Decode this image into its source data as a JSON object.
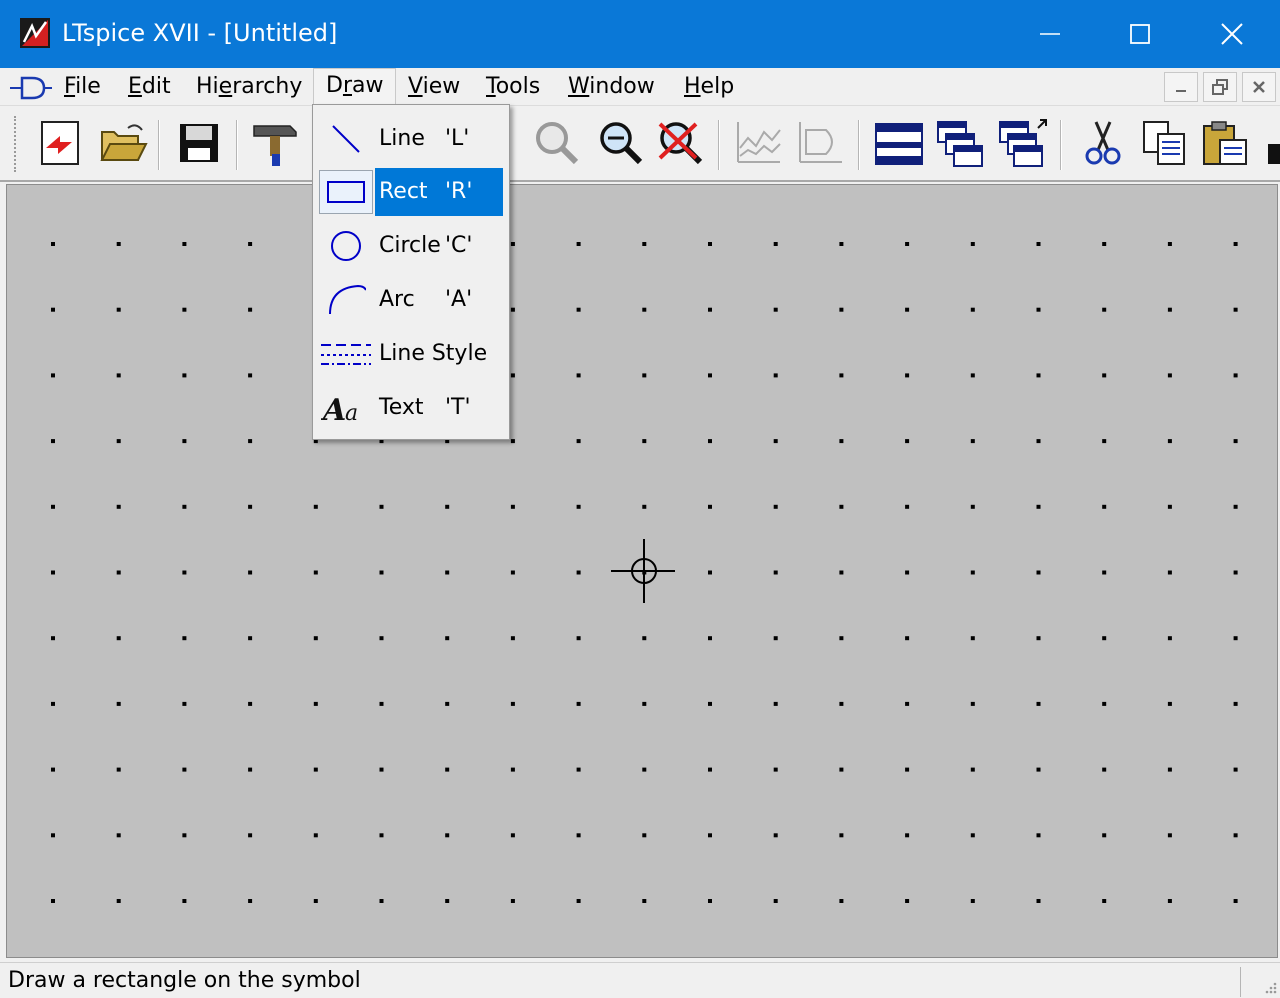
{
  "window": {
    "title": "LTspice XVII - [Untitled]"
  },
  "menubar": {
    "items": [
      {
        "label": "File"
      },
      {
        "label": "Edit"
      },
      {
        "label": "Hierarchy"
      },
      {
        "label": "Draw"
      },
      {
        "label": "View"
      },
      {
        "label": "Tools"
      },
      {
        "label": "Window"
      },
      {
        "label": "Help"
      }
    ]
  },
  "draw_menu": {
    "items": [
      {
        "label": "Line",
        "accel": "'L'",
        "icon": "line-icon"
      },
      {
        "label": "Rect",
        "accel": "'R'",
        "icon": "rect-icon",
        "selected": true
      },
      {
        "label": "Circle",
        "accel": "'C'",
        "icon": "circle-icon"
      },
      {
        "label": "Arc",
        "accel": "'A'",
        "icon": "arc-icon"
      },
      {
        "label": "Line Style",
        "accel": "",
        "icon": "line-style-icon"
      },
      {
        "label": "Text",
        "accel": "'T'",
        "icon": "text-icon"
      }
    ]
  },
  "toolbar": {
    "icons": [
      "new-schematic-icon",
      "open-folder-icon",
      "save-icon",
      "run-hammer-icon",
      "zoom-in-icon",
      "zoom-out-icon",
      "zoom-cancel-icon",
      "autoscale-icon",
      "waveform-icon",
      "tile-horizontal-icon",
      "cascade-icon",
      "close-window-icon",
      "cut-icon",
      "copy-icon",
      "paste-icon"
    ]
  },
  "status": {
    "text": "Draw a rectangle on the symbol"
  },
  "colors": {
    "titlebar": "#0a78d7",
    "canvas": "#c0c0c0",
    "menu_highlight": "#0078d7",
    "icon_blue": "#0000c8"
  }
}
